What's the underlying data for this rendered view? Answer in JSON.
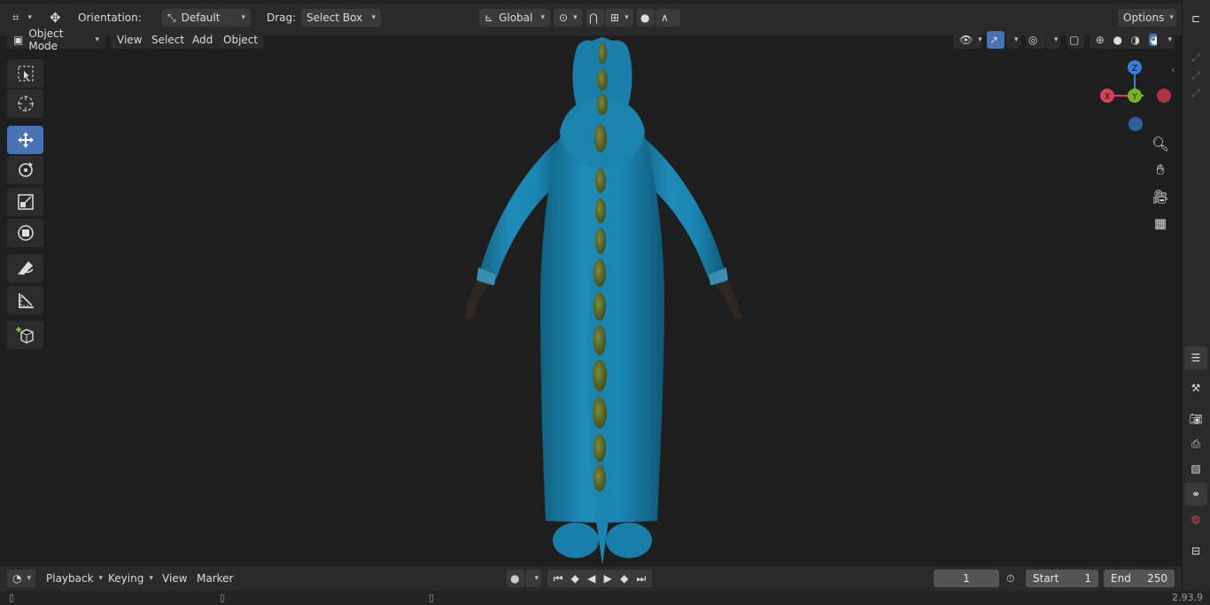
{
  "header": {
    "orientation_label": "Orientation:",
    "orientation_value": "Default",
    "drag_label": "Drag:",
    "drag_value": "Select Box",
    "transform_space": "Global",
    "options_label": "Options"
  },
  "viewport_header": {
    "mode": "Object Mode",
    "menus": [
      "View",
      "Select",
      "Add",
      "Object"
    ]
  },
  "gizmo": {
    "z": "Z",
    "x": "X",
    "y": "Y"
  },
  "timeline": {
    "menus": [
      "Playback",
      "Keying",
      "View",
      "Marker"
    ],
    "current_frame": "1",
    "start_label": "Start",
    "start_value": "1",
    "end_label": "End",
    "end_value": "250"
  },
  "status": {
    "version": "2.93.9"
  },
  "colors": {
    "accent": "#4772b3",
    "suit": "#1e8bb8",
    "spikes": "#5e6b2a",
    "axis_x": "#d9415a",
    "axis_y": "#7ab321",
    "axis_z": "#3b7fd0"
  },
  "icons": {
    "toolbar": [
      "select-box-icon",
      "cursor-icon",
      "move-icon",
      "rotate-icon",
      "scale-icon",
      "transform-icon",
      "annotate-icon",
      "measure-icon",
      "add-cube-icon"
    ],
    "navigation": [
      "zoom-icon",
      "hand-pan-icon",
      "camera-icon",
      "grid-icon"
    ]
  }
}
